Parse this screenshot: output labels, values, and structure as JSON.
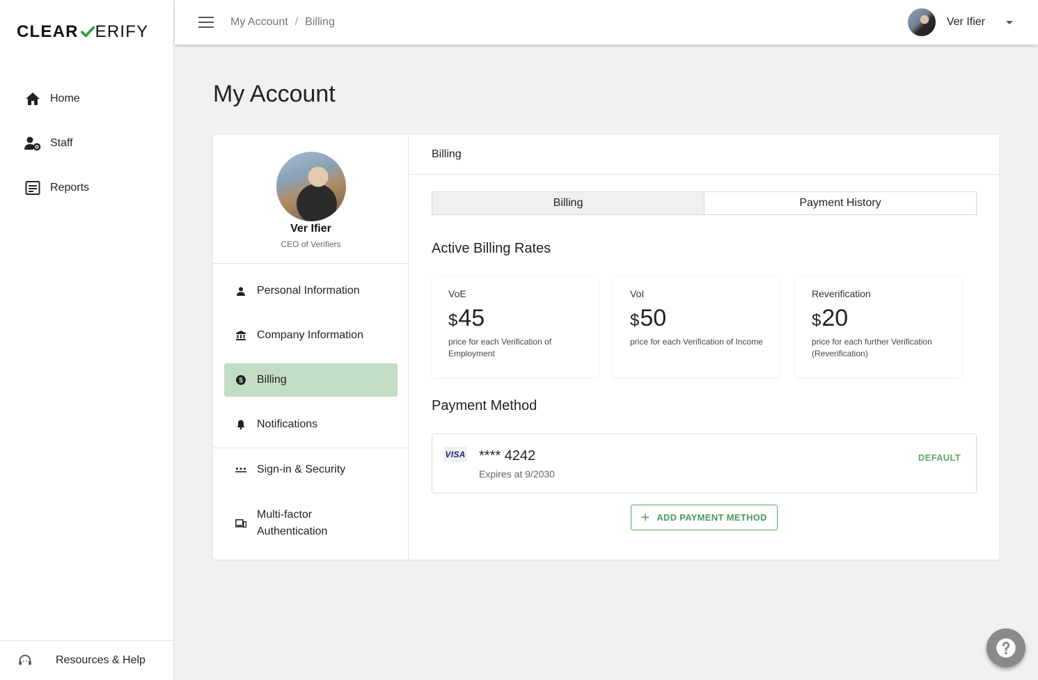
{
  "brand": {
    "name_bold": "CLEAR",
    "name_light": "ERIFY",
    "accent": "#2e9e3e"
  },
  "sidebar": {
    "items": [
      {
        "label": "Home",
        "icon": "home-icon"
      },
      {
        "label": "Staff",
        "icon": "staff-settings-icon"
      },
      {
        "label": "Reports",
        "icon": "reports-icon"
      }
    ],
    "footer_label": "Resources & Help",
    "footer_icon": "headset-icon"
  },
  "topbar": {
    "breadcrumb": [
      "My Account",
      "Billing"
    ],
    "breadcrumb_sep": "/",
    "user_name": "Ver Ifier"
  },
  "page": {
    "title": "My Account"
  },
  "profile": {
    "name": "Ver Ifier",
    "role": "CEO of Verifiers",
    "menu": [
      {
        "label": "Personal Information",
        "icon": "person-icon"
      },
      {
        "label": "Company Information",
        "icon": "bank-icon"
      },
      {
        "label": "Billing",
        "icon": "dollar-icon",
        "active": true
      },
      {
        "label": "Notifications",
        "icon": "bell-icon"
      },
      {
        "label": "Sign-in & Security",
        "icon": "password-icon"
      },
      {
        "label": "Multi-factor Authentication",
        "icon": "devices-icon"
      }
    ]
  },
  "billing": {
    "header": "Billing",
    "tabs": [
      "Billing",
      "Payment History"
    ],
    "active_tab": 0,
    "rates_title": "Active Billing Rates",
    "currency": "$",
    "rates": [
      {
        "label": "VoE",
        "price": "45",
        "desc": "price for each Verification of Employment"
      },
      {
        "label": "VoI",
        "price": "50",
        "desc": "price for each Verification of Income"
      },
      {
        "label": "Reverification",
        "price": "20",
        "desc": "price for each further Verification (Reverification)"
      }
    ],
    "payment_title": "Payment Method",
    "payment": {
      "brand": "VISA",
      "number": "**** 4242",
      "expires": "Expires at 9/2030",
      "badge": "DEFAULT"
    },
    "add_button": "ADD PAYMENT METHOD"
  },
  "colors": {
    "active_menu_bg": "#c3dcc5",
    "success_green": "#5ba865",
    "fab_bg": "#8a8a8a"
  }
}
